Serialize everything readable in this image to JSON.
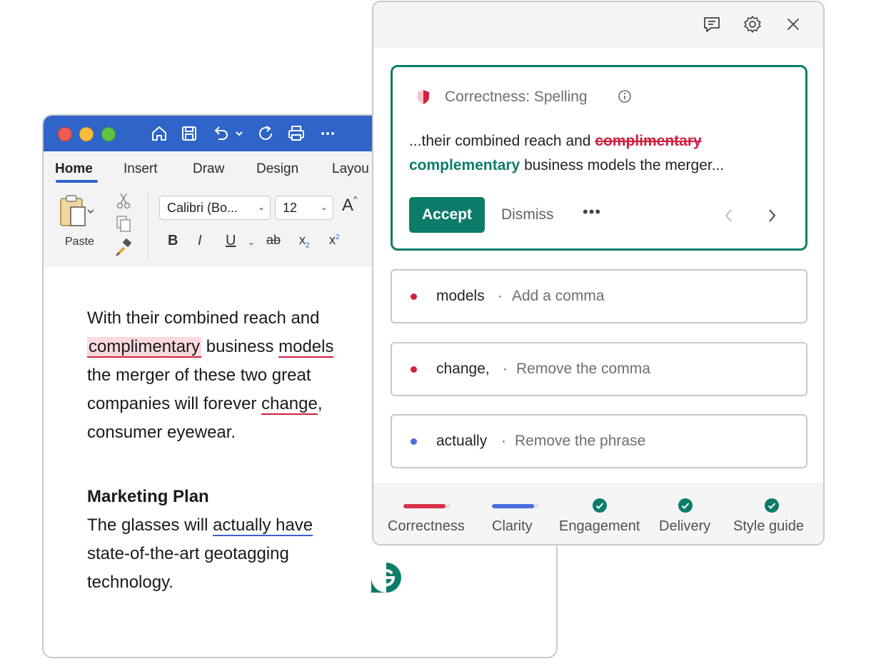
{
  "word": {
    "tabs": [
      "Home",
      "Insert",
      "Draw",
      "Design",
      "Layou"
    ],
    "active_tab": "Home",
    "ribbon": {
      "paste_label": "Paste",
      "font_name": "Calibri (Bo...",
      "font_size": "12",
      "grow_font": "A",
      "bold": "B",
      "italic": "I",
      "underline": "U",
      "strike": "ab",
      "subscript": "x",
      "subscript_mark": "2",
      "superscript": "x",
      "superscript_mark": "2"
    },
    "document": {
      "p1": {
        "line1": "With their combined reach and",
        "l2_flagged": "complimentary",
        "l2_mid": " business ",
        "l2_flagged2": "models",
        "line3": "the merger of these two great",
        "l4_pre": "companies will forever ",
        "l4_flagged": "change",
        "l4_post": ",",
        "line5": "consumer eyewear."
      },
      "heading": "Marketing Plan",
      "p2": {
        "l1_pre": "The glasses will ",
        "l1_flagged": "actually have",
        "line2": "state-of-the-art geotagging",
        "line3": "technology."
      }
    }
  },
  "panel": {
    "main_card": {
      "category": "Correctness: Spelling",
      "text_pre": "...their combined reach and ",
      "text_strike": "complimentary",
      "text_replacement": "complementary",
      "text_post": " business models the merger...",
      "accept_label": "Accept",
      "dismiss_label": "Dismiss",
      "more_label": "•••"
    },
    "suggestions": [
      {
        "word": "models",
        "separator": "·",
        "desc": "Add a comma",
        "dot_color": "#d0223e"
      },
      {
        "word": "change,",
        "separator": "·",
        "desc": "Remove the comma",
        "dot_color": "#d0223e"
      },
      {
        "word": "actually",
        "separator": "·",
        "desc": "Remove the phrase",
        "dot_color": "#4a6ee0"
      }
    ],
    "footer": [
      {
        "label": "Correctness",
        "status": "bar",
        "color": "#d83248",
        "progress": 0.9
      },
      {
        "label": "Clarity",
        "status": "bar",
        "color": "#4a6ee0",
        "progress": 0.9
      },
      {
        "label": "Engagement",
        "status": "check"
      },
      {
        "label": "Delivery",
        "status": "check"
      },
      {
        "label": "Style guide",
        "status": "check"
      }
    ],
    "colors": {
      "accent": "#0c7c6a",
      "error": "#d0223e",
      "clarity": "#4a6ee0"
    }
  }
}
